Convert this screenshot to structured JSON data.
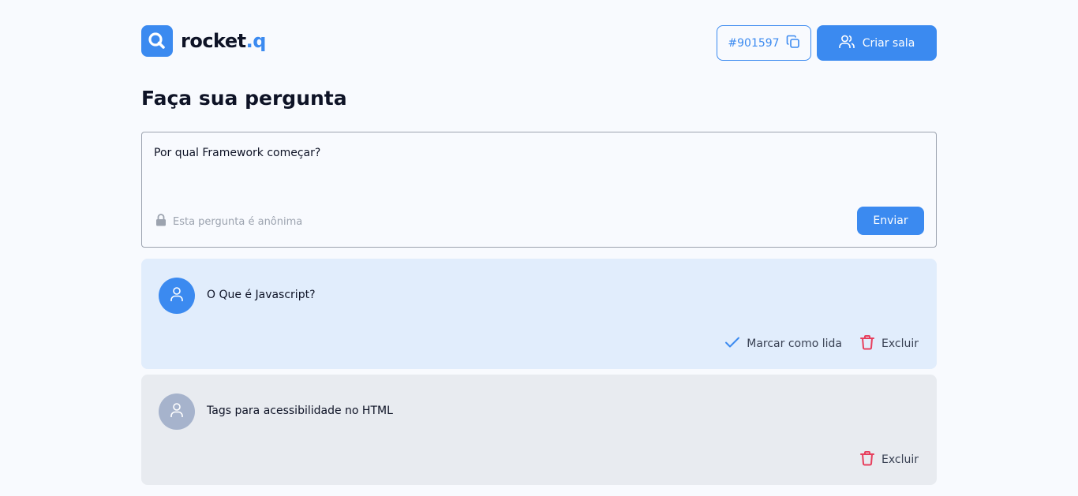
{
  "app": {
    "logo_text_main": "rocket",
    "logo_text_dot": ".q"
  },
  "header": {
    "room_code": "#901597",
    "create_room_label": "Criar sala"
  },
  "page": {
    "title": "Faça sua pergunta"
  },
  "form": {
    "question_value": "Por qual Framework começar?",
    "anonymous_note": "Esta pergunta é anônima",
    "send_label": "Enviar"
  },
  "questions": [
    {
      "text": "O Que é Javascript?",
      "mark_read_label": "Marcar como lida",
      "delete_label": "Excluir",
      "status": "unread"
    },
    {
      "text": "Tags para acessibilidade no HTML",
      "delete_label": "Excluir",
      "status": "read"
    }
  ],
  "colors": {
    "accent": "#3B8AF0",
    "background": "#F8FAFE",
    "unread_card": "#E1EDFC",
    "read_card": "#E8EBF0",
    "danger": "#E73F5D",
    "title": "#0E1326"
  },
  "icons": {
    "logo": "search-icon",
    "copy": "copy-icon",
    "users": "users-icon",
    "lock": "lock-icon",
    "user": "user-icon",
    "check": "check-icon",
    "trash": "trash-icon"
  }
}
